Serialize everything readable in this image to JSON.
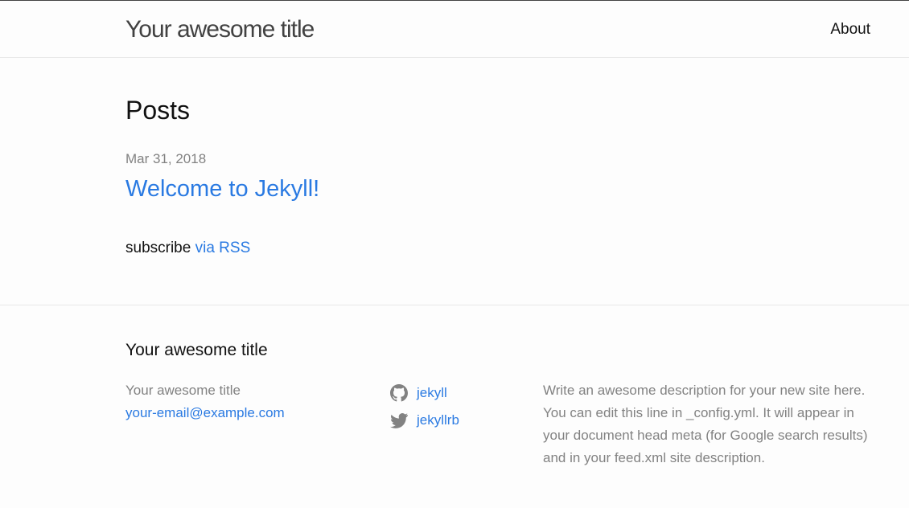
{
  "header": {
    "site_title": "Your awesome title",
    "nav": [
      {
        "label": "About"
      }
    ]
  },
  "main": {
    "heading": "Posts",
    "posts": [
      {
        "date": "Mar 31, 2018",
        "title": "Welcome to Jekyll!"
      }
    ],
    "rss": {
      "prefix": "subscribe",
      "link_text": "via RSS"
    }
  },
  "footer": {
    "heading": "Your awesome title",
    "name": "Your awesome title",
    "email": "your-email@example.com",
    "social": [
      {
        "icon": "github-icon",
        "label": "jekyll"
      },
      {
        "icon": "twitter-icon",
        "label": "jekyllrb"
      }
    ],
    "description": "Write an awesome description for your new site here. You can edit this line in _config.yml. It will appear in your document head meta (for Google search results) and in your feed.xml site description."
  },
  "colors": {
    "link": "#2a7ae2",
    "meta_text": "#828282",
    "header_title": "#424242",
    "border": "#e8e8e8",
    "background": "#fdfdfd"
  }
}
